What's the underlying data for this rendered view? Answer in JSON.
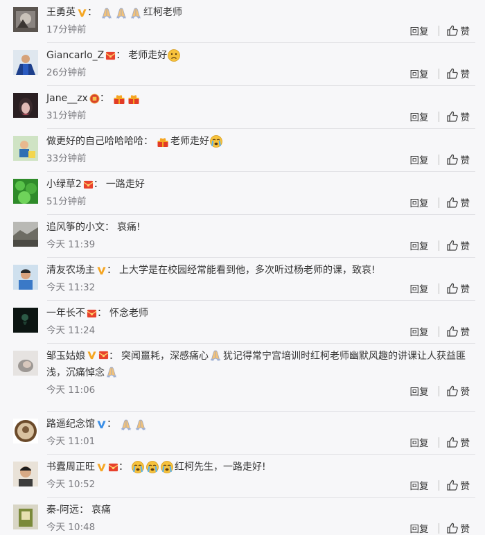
{
  "actions": {
    "reply_label": "回复",
    "like_label": "赞"
  },
  "comments": [
    {
      "user": "王勇英",
      "text": "红柯老师",
      "time": "17分钟前"
    },
    {
      "user": "Giancarlo_Z",
      "text": "老师走好",
      "time": "26分钟前"
    },
    {
      "user": "Jane__zx",
      "text": "",
      "time": "31分钟前"
    },
    {
      "user": "做更好的自己哈哈哈哈",
      "text": "老师走好",
      "time": "33分钟前"
    },
    {
      "user": "小绿草2",
      "text": "一路走好",
      "time": "51分钟前"
    },
    {
      "user": "追风筝的小文",
      "text": "哀痛!",
      "time": "今天 11:39"
    },
    {
      "user": "清友农场主",
      "text": "上大学是在校园经常能看到他，多次听过杨老师的课，致哀!",
      "time": "今天 11:32"
    },
    {
      "user": "一年长不",
      "text": "怀念老师",
      "time": "今天 11:24"
    },
    {
      "user": "邹玉姑娘",
      "text_a": "突闻噩耗，深感痛心",
      "text_b": "犹记得常宁宫培训时红柯老师幽默风趣的讲课让人获益匪浅，沉痛悼念",
      "time": "今天 11:06"
    },
    {
      "user": "路遥纪念馆",
      "text": "",
      "time": "今天 11:01"
    },
    {
      "user": "书蠹周正旺",
      "text": "红柯先生，一路走好!",
      "time": "今天 10:52"
    },
    {
      "user": "秦-阿远",
      "text": "哀痛",
      "time": "今天 10:48"
    }
  ],
  "colon": "：",
  "icons": {
    "verified_badge": "verified-v-badge",
    "red_envelope": "red-envelope-badge",
    "pray": "pray-emoji",
    "sad": "sad-face-emoji",
    "crying": "crying-face-emoji",
    "gift": "red-gift-emoji",
    "fu": "fu-badge",
    "thumb": "thumbs-up-icon"
  },
  "colors": {
    "verified": "#f5a623",
    "envelope": "#e8412c",
    "text": "#333333",
    "meta": "#7b7b80"
  }
}
